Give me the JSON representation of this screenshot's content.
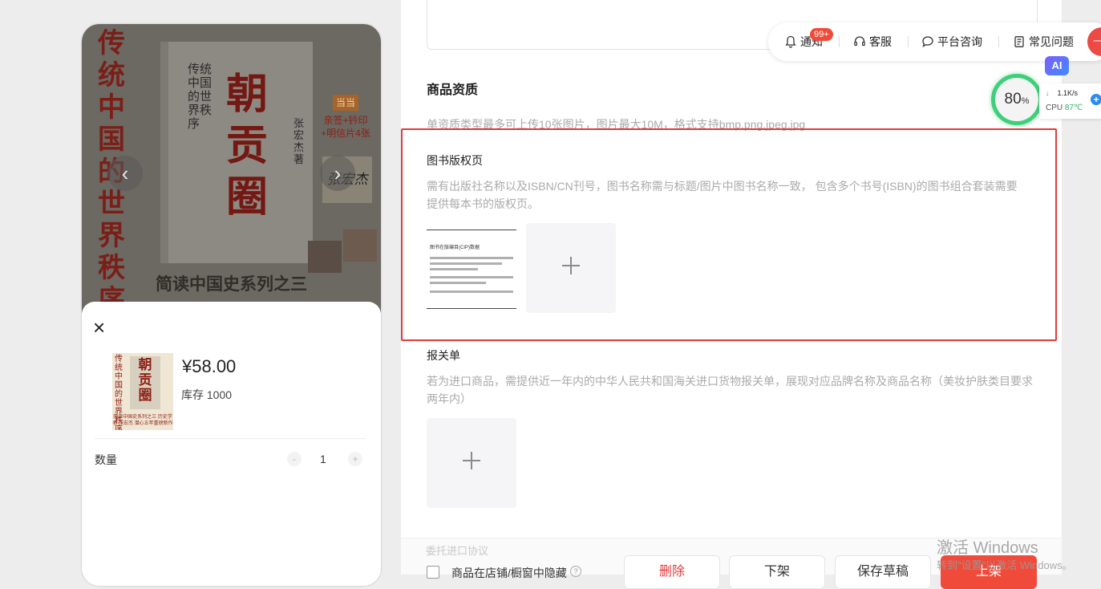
{
  "preview": {
    "cover": {
      "vertical_title": "传统中国的世界秩序",
      "book_main_title": "朝贡圈",
      "book_subtitle": "传统中国的世界秩序",
      "author": "张宏杰著",
      "promo_tag": "当当",
      "promo_text": "亲签+钤印 +明信片4张",
      "signature": "张宏杰",
      "bottom_text": "简读中国史系列之三"
    },
    "sheet": {
      "thumb_title": "传统中国的世界秩序",
      "thumb_main": "朝贡圈",
      "thumb_caption": "简读中国史系列之三 历史学者 张宏杰 潜心五年重磅新作",
      "price": "¥58.00",
      "stock": "库存 1000",
      "qty_label": "数量",
      "qty_minus": "-",
      "qty_value": "1",
      "qty_plus": "+"
    }
  },
  "form": {
    "section_title": "商品资质",
    "section_hint": "单资质类型最多可上传10张图片，图片最大10M，格式支持bmp,png,jpeg,jpg",
    "copyright": {
      "label": "图书版权页",
      "hint": "需有出版社名称以及ISBN/CN刊号，图书名称需与标题/图片中图书名称一致， 包含多个书号(ISBN)的图书组合套装需要提供每本书的版权页。",
      "doc_title": "图书在版编目(CIP)数据"
    },
    "customs": {
      "label": "报关单",
      "hint": "若为进口商品，需提供近一年内的中华人民共和国海关进口货物报关单，展现对应品牌名称及商品名称（美妆护肤类目要求两年内）"
    },
    "footer": {
      "note": "委托进口协议",
      "hide_label": "商品在店铺/橱窗中隐藏",
      "help": "?",
      "buttons": {
        "delete": "删除",
        "offline": "下架",
        "save_draft": "保存草稿",
        "online": "上架"
      }
    }
  },
  "topbar": {
    "notify": "通知",
    "notify_badge": "99+",
    "service": "客服",
    "consult": "平台咨询",
    "faq": "常见问题",
    "avatar_text": "一键"
  },
  "widgets": {
    "ai": "AI",
    "gauge_value": "80",
    "gauge_unit": "%",
    "net_speed": "1.1K/s",
    "cpu_label": "CPU",
    "cpu_temp": "87℃",
    "plus": "+"
  },
  "watermark": {
    "line1": "激活 Windows",
    "line2": "转到\"设置\"以激活 Windows。"
  },
  "colors": {
    "accent": "#f04b3a",
    "highlight_frame": "#e23b3b",
    "gauge": "#3ecf7a"
  }
}
